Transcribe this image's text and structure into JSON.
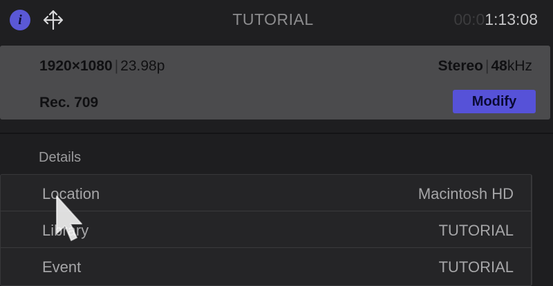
{
  "header": {
    "info_icon": "i",
    "share_icon": "share-arrows-icon",
    "title": "TUTORIAL",
    "timecode_dim": "00:0",
    "timecode_bright": "1:13:08"
  },
  "format": {
    "resolution": "1920",
    "times": "×",
    "resolution_h": "1080",
    "separator": "|",
    "frame_rate": "23.98p",
    "audio_channels": "Stereo",
    "sample_rate": "48",
    "sample_unit": "kHz",
    "color_space": "Rec. 709",
    "modify_label": "Modify"
  },
  "details": {
    "heading": "Details",
    "rows": [
      {
        "label": "Location",
        "value": "Macintosh HD"
      },
      {
        "label": "Library",
        "value": "TUTORIAL"
      },
      {
        "label": "Event",
        "value": "TUTORIAL"
      }
    ]
  },
  "colors": {
    "accent": "#5652d8",
    "panel": "#4b4b4d",
    "background": "#1e1e20"
  }
}
